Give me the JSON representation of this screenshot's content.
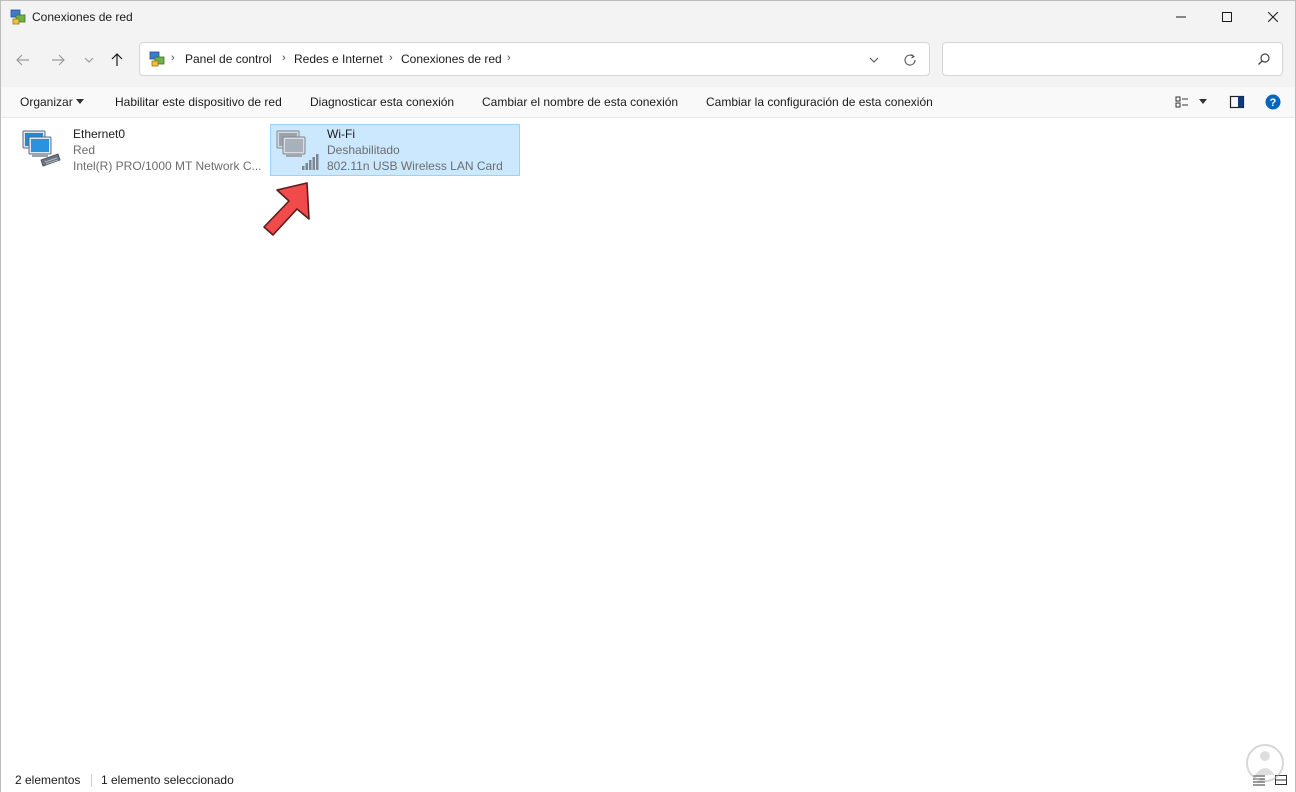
{
  "window": {
    "title": "Conexiones de red"
  },
  "address": {
    "crumbs": [
      "Panel de control",
      "Redes e Internet",
      "Conexiones de red"
    ]
  },
  "search": {
    "placeholder": ""
  },
  "commands": {
    "organize": "Organizar",
    "enable": "Habilitar este dispositivo de red",
    "diagnose": "Diagnosticar esta conexión",
    "rename": "Cambiar el nombre de esta conexión",
    "settings": "Cambiar la configuración de esta conexión"
  },
  "connections": [
    {
      "name": "Ethernet0",
      "status": "Red",
      "device": "Intel(R) PRO/1000 MT Network C...",
      "icon": "ethernet-adapter-icon",
      "selected": false
    },
    {
      "name": "Wi-Fi",
      "status": "Deshabilitado",
      "device": "802.11n USB Wireless LAN Card",
      "icon": "wifi-adapter-icon",
      "selected": true
    }
  ],
  "statusbar": {
    "count": "2 elementos",
    "selection": "1 elemento seleccionado"
  },
  "colors": {
    "selection_bg": "#cce8ff",
    "selection_border": "#99d1ff",
    "arrow": "#f04a4a",
    "help": "#0067c0"
  }
}
